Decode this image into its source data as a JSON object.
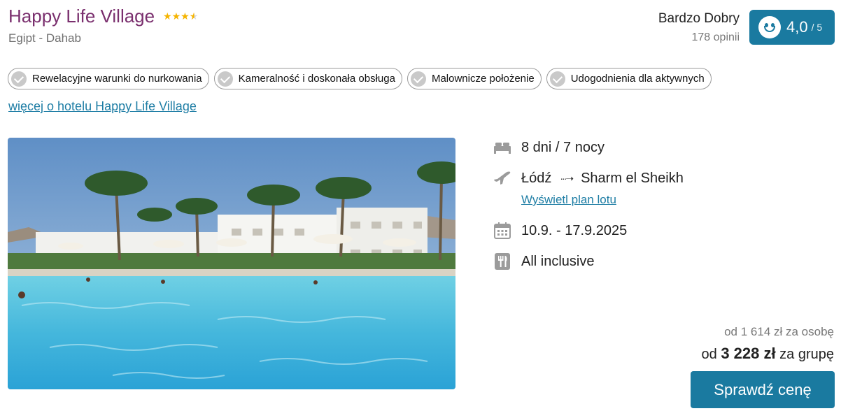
{
  "hotel": {
    "name": "Happy Life Village",
    "stars": 3.5,
    "location": "Egipt - Dahab",
    "more_link": "więcej o hotelu Happy Life Village"
  },
  "rating": {
    "label": "Bardzo Dobry",
    "count": "178 opinii",
    "value": "4,0",
    "max": "/ 5"
  },
  "tags": [
    {
      "label": "Rewelacyjne warunki do nurkowania"
    },
    {
      "label": "Kameralność i doskonała obsługa"
    },
    {
      "label": "Malownicze położenie"
    },
    {
      "label": "Udogodnienia dla aktywnych"
    }
  ],
  "trip": {
    "duration": "8 dni / 7 nocy",
    "from": "Łódź",
    "to": "Sharm el Sheikh",
    "plan_link": "Wyświetl plan lotu",
    "dates": "10.9. - 17.9.2025",
    "board": "All inclusive"
  },
  "price": {
    "per_person": "od 1 614 zł za osobę",
    "group_prefix": "od",
    "group_amount": "3 228 zł",
    "group_suffix": "za grupę",
    "cta": "Sprawdź cenę"
  },
  "icons": {
    "bed": "bed-icon",
    "plane": "plane-icon",
    "calendar": "calendar-icon",
    "food": "food-icon",
    "smiley": "smiley-icon",
    "check": "check-icon"
  },
  "colors": {
    "title": "#7a2f6e",
    "accent": "#1a7aa0",
    "link": "#1f7ea5",
    "star": "#f5b400"
  }
}
